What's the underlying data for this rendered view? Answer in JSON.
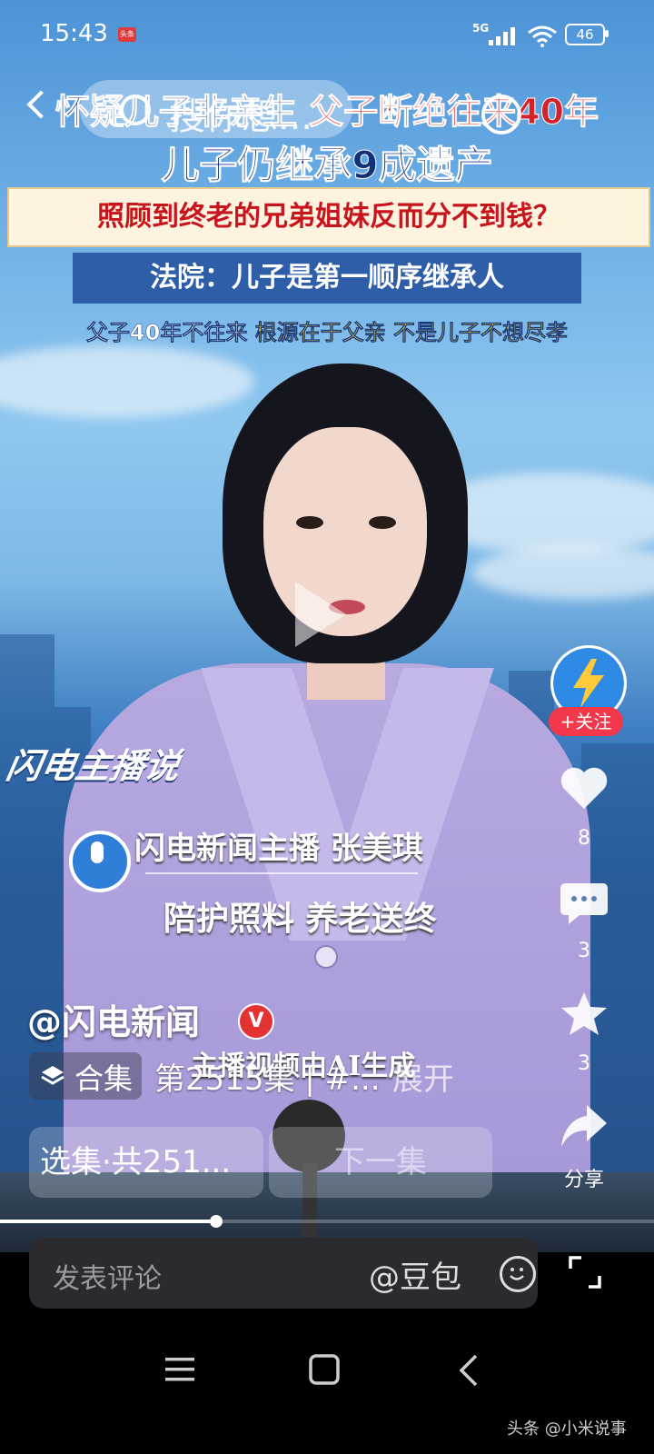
{
  "status_bar": {
    "time": "15:43",
    "app_badge": "头条",
    "network": "5G",
    "battery": "46"
  },
  "search": {
    "placeholder": "搜你想..."
  },
  "headline": {
    "line1_left": "怀疑儿子非亲生",
    "line1_right": "父子断绝往来40年",
    "line2": "儿子仍继承9成遗产",
    "line3": "照顾到终老的兄弟姐妹反而分不到钱？",
    "line4": "法院：儿子是第一顺序继承人",
    "line5_left": "父子40年不往来",
    "line5_right": "根源在于父亲 不是儿子不想尽孝"
  },
  "overlay": {
    "brand": "闪电主播说",
    "anchor_name": "闪电新闻主播 张美琪",
    "anchor_sub": "陪护照料 养老送终",
    "ai_note": "主播视频由AI生成"
  },
  "post": {
    "account": "@闪电新闻",
    "verified": "V",
    "collection_label": "合集",
    "description": "第2515集 | #...",
    "expand": "展开",
    "episodes_button": "选集·共251...",
    "next_button": "下一集"
  },
  "progress": {
    "fraction": 0.33
  },
  "sidebar": {
    "follow": "+关注",
    "likes": "8",
    "comments": "3",
    "favorites": "3",
    "share": "分享"
  },
  "comment_bar": {
    "placeholder": "发表评论",
    "mention": "@豆包"
  },
  "watermark": "头条 @小米说事",
  "colors": {
    "headline_navy": "#13307a",
    "headline_red": "#d4222a",
    "follow_red": "#f2384a",
    "suit_purple": "#b8a9e0"
  }
}
